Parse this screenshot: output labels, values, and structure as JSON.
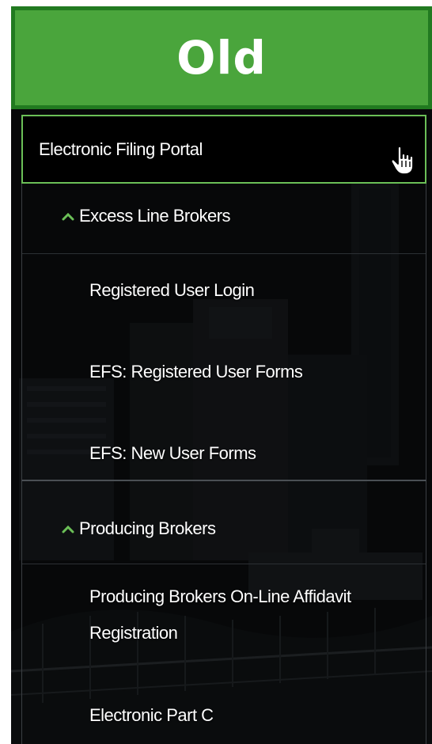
{
  "banner": {
    "label": "Old"
  },
  "portal": {
    "title": "Electronic Filing Portal"
  },
  "sections": [
    {
      "title": "Excess Line Brokers",
      "items": [
        {
          "label": "Registered User Login"
        },
        {
          "label": "EFS: Registered User Forms"
        },
        {
          "label": "EFS: New User Forms"
        }
      ]
    },
    {
      "title": "Producing Brokers",
      "items": [
        {
          "label": "Producing Brokers On-Line Affidavit Registration"
        },
        {
          "label": "Electronic Part C"
        }
      ]
    }
  ],
  "colors": {
    "banner_bg": "#4aa53c",
    "banner_border": "#217a20",
    "accent_green": "#6bbf57",
    "panel_bg": "#0b0d0f"
  },
  "icons": {
    "portal_cursor": "hand-pointer-icon",
    "section_toggle": "chevron-up-icon"
  }
}
